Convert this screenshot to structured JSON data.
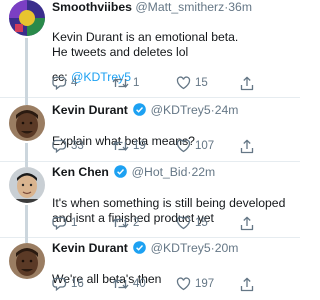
{
  "colors": {
    "accent": "#1da1f2",
    "muted": "#657786",
    "text": "#14171a",
    "divider": "#e6ecf0",
    "verified": "#1da1f2"
  },
  "tweets": [
    {
      "name": "Smoothviibes",
      "handle": "@Matt_smitherz",
      "sep": "·",
      "time": "36m",
      "verified": false,
      "text": "Kevin Durant is an emotional beta.\n  He tweets and deletes lol",
      "cc_prefix": "cc: ",
      "cc_link": "@KDTrey5",
      "reply_icon": "reply-icon",
      "replies": "4",
      "retweets": "1",
      "likes": "15"
    },
    {
      "name": "Kevin Durant",
      "handle": "@KDTrey5",
      "sep": "·",
      "time": "24m",
      "verified": true,
      "text": "Explain what beta means?",
      "replies": "33",
      "retweets": "19",
      "likes": "107"
    },
    {
      "name": "Ken Chen",
      "handle": "@Hot_Bid",
      "sep": "·",
      "time": "22m",
      "verified": true,
      "text": "It's when something is still being developed and isnt a finished product yet",
      "replies": "1",
      "retweets": "2",
      "likes": "15"
    },
    {
      "name": "Kevin Durant",
      "handle": "@KDTrey5",
      "sep": "·",
      "time": "20m",
      "verified": true,
      "text": "We're all beta's then",
      "replies": "16",
      "retweets": "40",
      "likes": "197"
    }
  ]
}
